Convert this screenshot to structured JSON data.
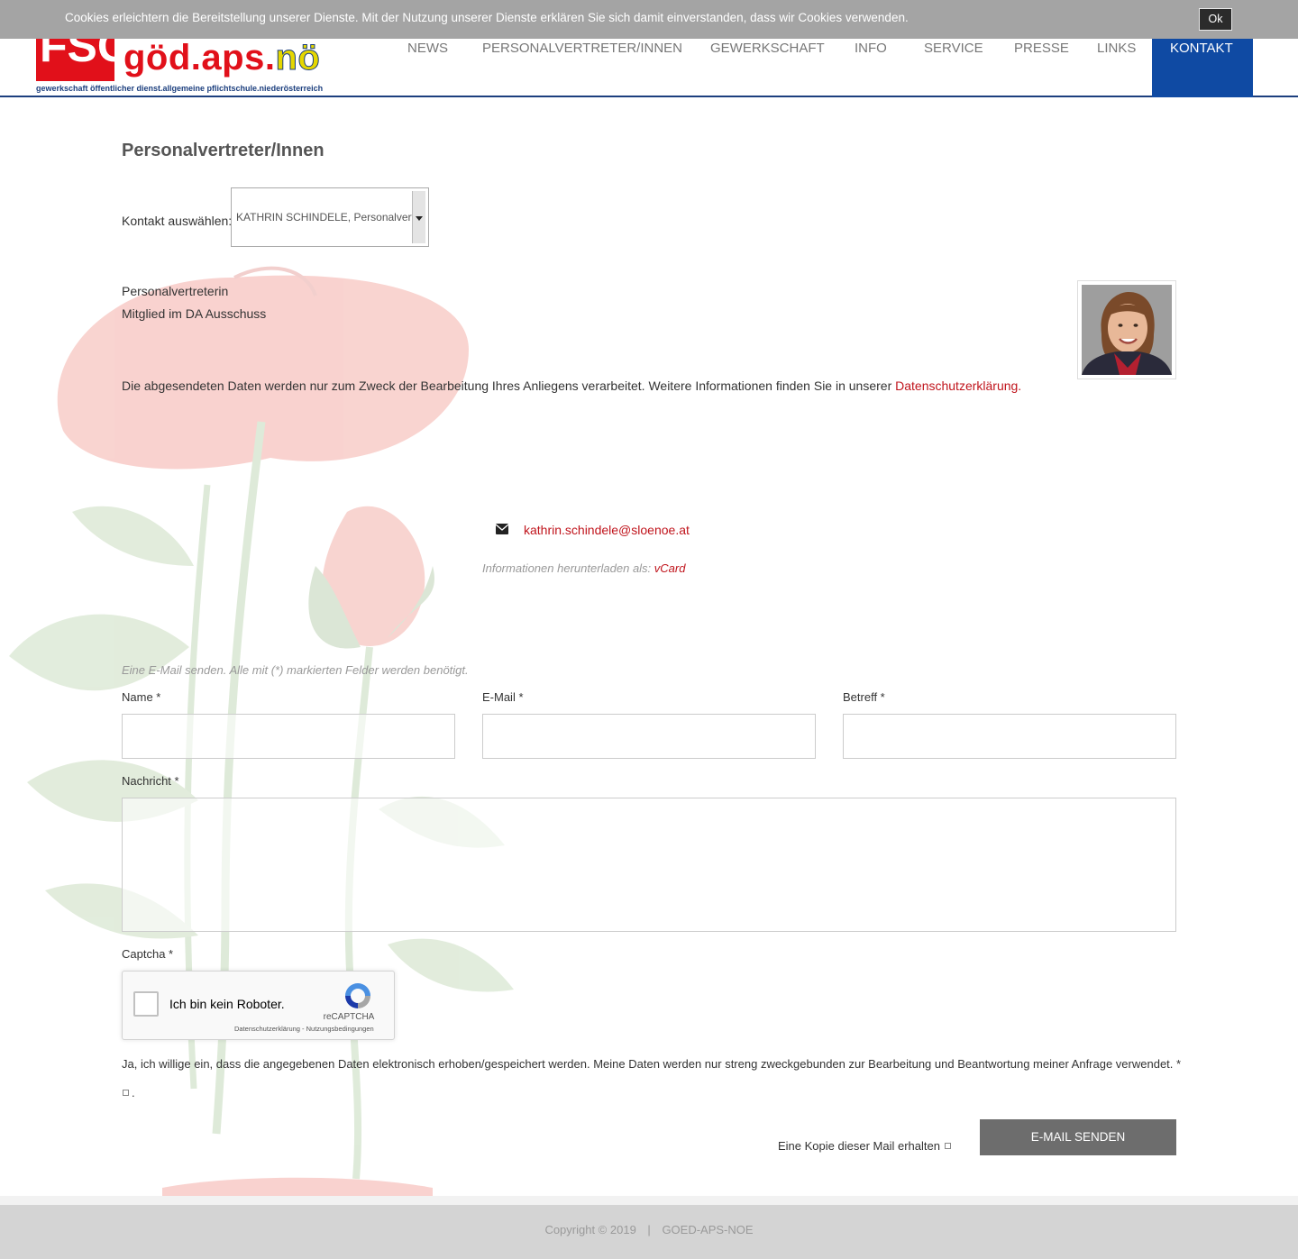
{
  "cookie_bar": {
    "text": "Cookies erleichtern die Bereitstellung unserer Dienste. Mit der Nutzung unserer Dienste erklären Sie sich damit einverstanden, dass wir Cookies verwenden.",
    "ok_label": "Ok"
  },
  "logo": {
    "mark": "FSG",
    "name_main": "göd.aps.",
    "name_accent": "nö",
    "subtitle": "gewerkschaft öffentlicher dienst.allgemeine pflichtschule.niederösterreich"
  },
  "nav": {
    "items": [
      "NEWS",
      "PERSONALVERTRETER/INNEN",
      "GEWERKSCHAFT",
      "INFO",
      "SERVICE",
      "PRESSE",
      "LINKS",
      "KONTAKT"
    ],
    "active": "KONTAKT"
  },
  "page": {
    "title": "Personalvertreter/Innen",
    "select_label": "Kontakt auswählen:",
    "select_value": "KATHRIN SCHINDELE, Personalvertr",
    "position_lines": [
      "Personalvertreterin",
      "Mitglied im DA Ausschuss"
    ],
    "privacy_text": "Die abgesendeten Daten werden nur zum Zweck der Bearbeitung Ihres Anliegens verarbeitet. Weitere Informationen finden Sie in unserer ",
    "privacy_link": "Datenschutzerklärung.",
    "email": "kathrin.schindele@sloenoe.at",
    "vcard_prefix": "Informationen herunterladen als: ",
    "vcard_link": "vCard"
  },
  "form": {
    "note": "Eine E-Mail senden. Alle mit (*) markierten Felder werden benötigt.",
    "name_label": "Name *",
    "email_label": "E-Mail *",
    "subject_label": "Betreff *",
    "message_label": "Nachricht *",
    "captcha_label": "Captcha *",
    "recaptcha": {
      "label": "Ich bin kein Roboter.",
      "brand": "reCAPTCHA",
      "terms": "Datenschutzerklärung - Nutzungsbedingungen"
    },
    "consent_text": "Ja, ich willige ein, dass die angegebenen Daten elektronisch erhoben/gespeichert werden. Meine Daten werden nur streng zweckgebunden zur Bearbeitung und Beantwortung meiner Anfrage verwendet. *",
    "consent_suffix": ".",
    "copy_label": "Eine Kopie dieser Mail erhalten",
    "send_label": "E-MAIL SENDEN"
  },
  "footer": {
    "copyright": "Copyright © 2019",
    "separator": "|",
    "site": "GOED-APS-NOE"
  },
  "colors": {
    "accent_blue": "#0f4aa3",
    "link_red": "#c0141c",
    "logo_red": "#e1101a",
    "cookie_bg": "#a4a4a4",
    "button_gray": "#6d6d6d"
  }
}
